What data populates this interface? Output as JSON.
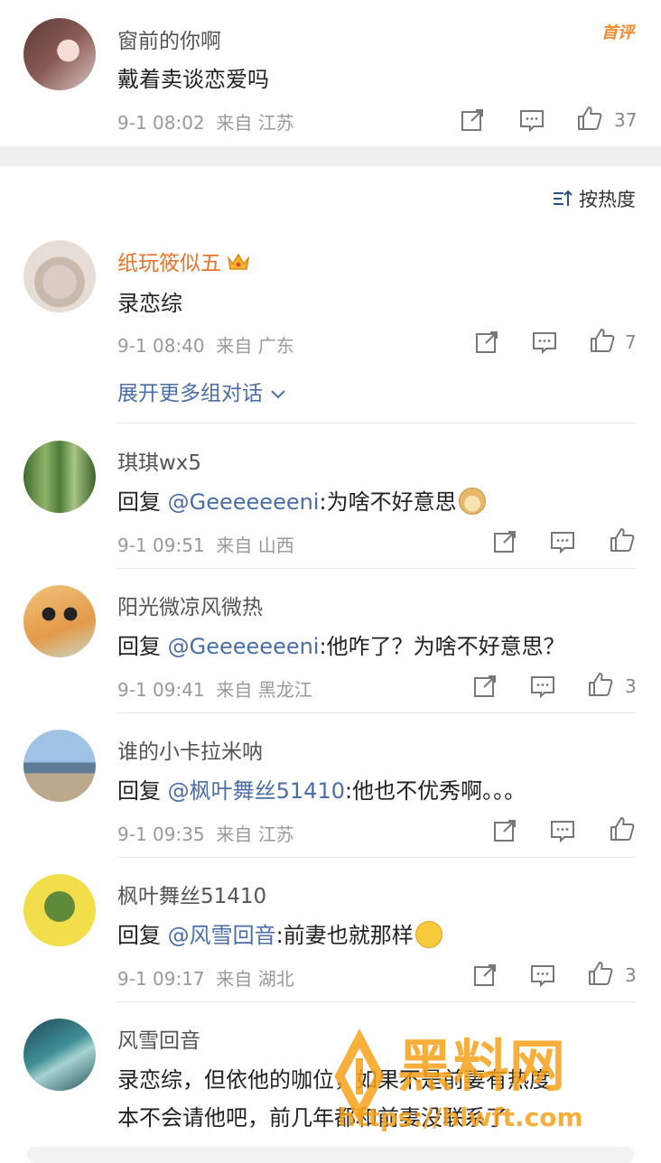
{
  "top_comment": {
    "username": "窗前的你啊",
    "text": "戴着卖谈恋爱吗",
    "time": "9-1 08:02",
    "location": "来自 江苏",
    "likes": "37",
    "badge": "首评"
  },
  "sort": {
    "label": "按热度"
  },
  "main_comment": {
    "username": "纸玩筱似五",
    "text": "录恋综",
    "time": "9-1 08:40",
    "location": "来自 广东",
    "likes": "7",
    "expand": "展开更多组对话"
  },
  "replies": [
    {
      "username": "琪琪wx5",
      "prefix": "回复 ",
      "mention": "@Geeeeeeeni",
      "text": ":为啥不好意思",
      "time": "9-1 09:51",
      "location": "来自 山西",
      "likes": ""
    },
    {
      "username": "阳光微凉风微热",
      "prefix": "回复 ",
      "mention": "@Geeeeeeeni",
      "text": ":他咋了？为啥不好意思？",
      "time": "9-1 09:41",
      "location": "来自 黑龙江",
      "likes": "3"
    },
    {
      "username": "谁的小卡拉米呐",
      "prefix": "回复 ",
      "mention": "@枫叶舞丝51410",
      "text": ":他也不优秀啊。。。",
      "time": "9-1 09:35",
      "location": "来自 江苏",
      "likes": ""
    },
    {
      "username": "枫叶舞丝51410",
      "prefix": "回复 ",
      "mention": "@风雪回音",
      "text": ":前妻也就那样",
      "time": "9-1 09:17",
      "location": "来自 湖北",
      "likes": "3"
    },
    {
      "username": "风雪回音",
      "line1": "录恋综，但依他的咖位，如果不是前妻有热度",
      "line2": "本不会请他吧，前几年都和前妻没联系了"
    }
  ],
  "watermark": {
    "text": "黑料网",
    "url": "https://hlwft.com"
  }
}
